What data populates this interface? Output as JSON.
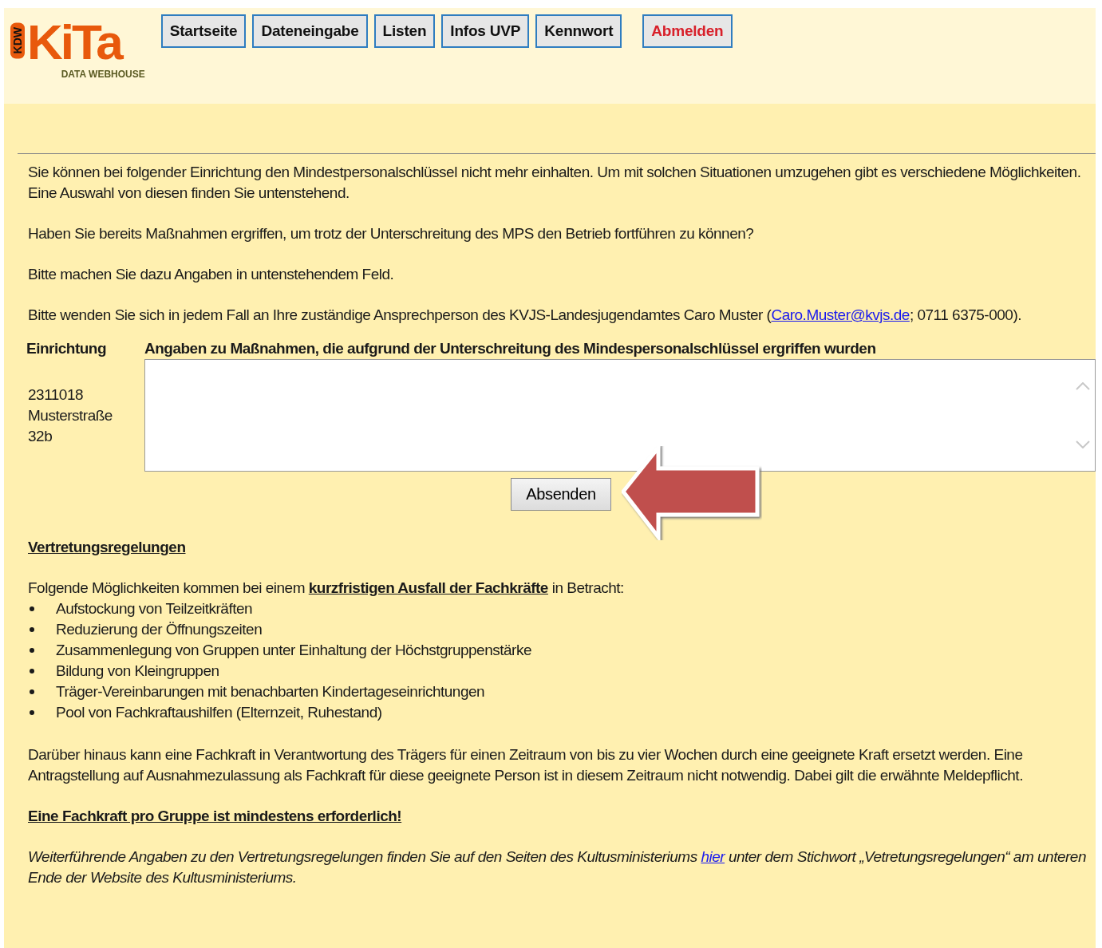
{
  "header": {
    "logo": {
      "mark": "KDW",
      "name": "KiTa",
      "tagline": "DATA WEBHOUSE"
    },
    "nav": [
      {
        "label": "Startseite",
        "kind": "nav"
      },
      {
        "label": "Dateneingabe",
        "kind": "nav"
      },
      {
        "label": "Listen",
        "kind": "nav"
      },
      {
        "label": "Infos UVP",
        "kind": "nav"
      },
      {
        "label": "Kennwort",
        "kind": "nav"
      },
      {
        "label": "Abmelden",
        "kind": "logout"
      }
    ]
  },
  "intro": {
    "paragraphs": [
      "Sie können bei folgender Einrichtung den Mindestpersonalschlüssel nicht mehr einhalten. Um mit solchen Situationen umzugehen gibt es verschiedene Möglichkeiten. Eine Auswahl von diesen finden Sie untenstehend.",
      "Haben Sie bereits Maßnahmen ergriffen, um trotz der Unterschreitung des MPS den Betrieb fortführen zu können?",
      "Bitte machen Sie dazu Angaben in untenstehendem Feld."
    ],
    "contact": {
      "before": "Bitte wenden Sie sich in jedem Fall an Ihre zuständige Ansprechperson des KVJS-Landesjugendamtes Caro Muster (",
      "email": "Caro.Muster@kvjs.de",
      "after": "; 0711 6375-000)."
    }
  },
  "form": {
    "facility_heading": "Einrichtung",
    "measures_heading": "Angaben zu Maßnahmen, die aufgrund der Unterschreitung des Mindespersonalschlüssel ergriffen wurden",
    "facility_lines": [
      "2311018",
      "Musterstraße",
      "32b"
    ],
    "submit": "Absenden"
  },
  "rules": {
    "heading": "Vertretungsregelungen",
    "lead": "Folgende Möglichkeiten kommen bei einem **kurzfristigen Ausfall der Fachkräfte** in Betracht:",
    "items": [
      "Aufstockung von Teilzeitkräften",
      "Reduzierung der Öffnungszeiten",
      "Zusammenlegung von Gruppen unter Einhaltung der Höchstgruppenstärke",
      "Bildung von Kleingruppen",
      "Träger-Vereinbarungen mit benachbarten Kindertageseinrichtungen",
      "Pool von Fachkraftaushilfen (Elternzeit, Ruhestand)"
    ],
    "paragraph": "Darüber hinaus kann eine Fachkraft in Verantwortung des Trägers für einen Zeitraum von bis zu vier Wochen durch eine geeignete Kraft ersetzt werden. Eine Antragstellung auf Ausnahmezulassung als Fachkraft für diese geeignete Person ist in diesem Zeitraum nicht notwendig. Dabei gilt die erwähnte Meldepflicht.",
    "emphasis": "Eine Fachkraft pro Gruppe ist mindestens erforderlich!",
    "note": {
      "before": "Weiterführende Angaben zu den Vertretungsregelungen finden Sie auf den Seiten des Kultusministeriums ",
      "link": "hier",
      "after": " unter dem Stichwort „Vetretungsregelungen“ am unteren Ende der Website des Kultusministeriums."
    }
  }
}
